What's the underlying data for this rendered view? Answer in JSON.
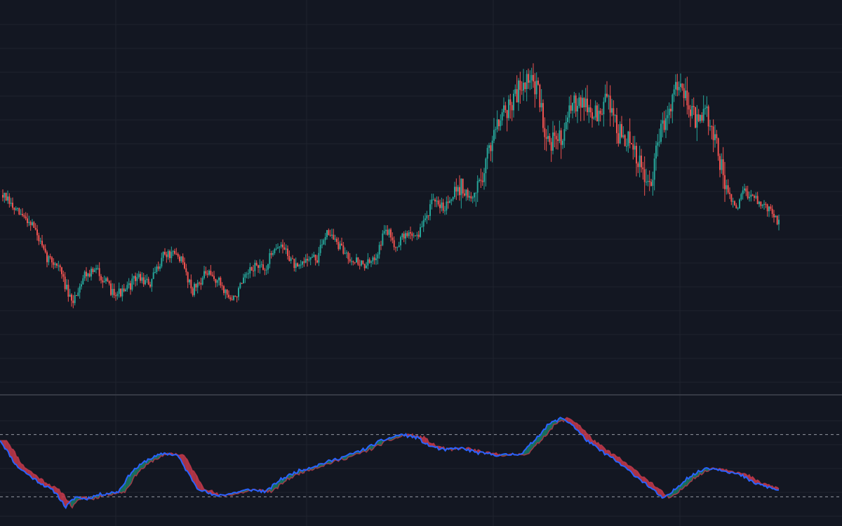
{
  "colors": {
    "background": "#131722",
    "grid": "#1f232e",
    "pane_divider": "#363a45",
    "up": "#26a69a",
    "down": "#ef5350",
    "osc_blue": "#2962ff",
    "osc_fill_up": "#1b7a64",
    "osc_fill_down": "#c2384a",
    "level_line": "#9598a1"
  },
  "chart_data": [
    {
      "type": "candlestick",
      "title": "",
      "price_range": [
        0,
        100
      ],
      "grid": true,
      "price_axis_labels": "none",
      "time_axis_labels": "none",
      "keypoints": [
        [
          0,
          58
        ],
        [
          8,
          52
        ],
        [
          18,
          48
        ],
        [
          26,
          36
        ],
        [
          34,
          33
        ],
        [
          42,
          19
        ],
        [
          50,
          30
        ],
        [
          58,
          31
        ],
        [
          66,
          24
        ],
        [
          74,
          23
        ],
        [
          82,
          29
        ],
        [
          90,
          26
        ],
        [
          98,
          37
        ],
        [
          108,
          36
        ],
        [
          116,
          24
        ],
        [
          124,
          30
        ],
        [
          132,
          27
        ],
        [
          140,
          20
        ],
        [
          148,
          28
        ],
        [
          154,
          33
        ],
        [
          160,
          31
        ],
        [
          166,
          40
        ],
        [
          172,
          39
        ],
        [
          180,
          31
        ],
        [
          186,
          36
        ],
        [
          192,
          35
        ],
        [
          198,
          46
        ],
        [
          206,
          39
        ],
        [
          212,
          36
        ],
        [
          220,
          33
        ],
        [
          226,
          34
        ],
        [
          234,
          46
        ],
        [
          240,
          40
        ],
        [
          246,
          44
        ],
        [
          254,
          44
        ],
        [
          262,
          55
        ],
        [
          270,
          54
        ],
        [
          278,
          62
        ],
        [
          286,
          56
        ],
        [
          294,
          67
        ],
        [
          302,
          86
        ],
        [
          310,
          90
        ],
        [
          318,
          99
        ],
        [
          326,
          97
        ],
        [
          332,
          79
        ],
        [
          338,
          76
        ],
        [
          346,
          86
        ],
        [
          352,
          94
        ],
        [
          358,
          88
        ],
        [
          364,
          86
        ],
        [
          370,
          93
        ],
        [
          376,
          80
        ],
        [
          382,
          77
        ],
        [
          390,
          67
        ],
        [
          396,
          60
        ],
        [
          400,
          77
        ],
        [
          406,
          88
        ],
        [
          412,
          99
        ],
        [
          418,
          93
        ],
        [
          424,
          83
        ],
        [
          430,
          87
        ],
        [
          436,
          75
        ],
        [
          442,
          60
        ],
        [
          448,
          52
        ],
        [
          452,
          60
        ],
        [
          460,
          56
        ],
        [
          468,
          53
        ],
        [
          474,
          48
        ]
      ],
      "n_candles": 475,
      "seed": 7
    },
    {
      "type": "area",
      "title": "",
      "ylim": [
        0,
        100
      ],
      "levels": [
        80,
        20
      ],
      "keypoints": [
        [
          0,
          75
        ],
        [
          10,
          50
        ],
        [
          20,
          38
        ],
        [
          34,
          24
        ],
        [
          40,
          10
        ],
        [
          46,
          20
        ],
        [
          52,
          18
        ],
        [
          60,
          22
        ],
        [
          72,
          25
        ],
        [
          80,
          44
        ],
        [
          90,
          56
        ],
        [
          100,
          62
        ],
        [
          108,
          60
        ],
        [
          114,
          44
        ],
        [
          120,
          29
        ],
        [
          130,
          21
        ],
        [
          140,
          23
        ],
        [
          152,
          27
        ],
        [
          162,
          25
        ],
        [
          170,
          36
        ],
        [
          180,
          44
        ],
        [
          196,
          52
        ],
        [
          212,
          60
        ],
        [
          222,
          66
        ],
        [
          232,
          74
        ],
        [
          244,
          80
        ],
        [
          254,
          77
        ],
        [
          260,
          70
        ],
        [
          270,
          65
        ],
        [
          280,
          67
        ],
        [
          292,
          62
        ],
        [
          306,
          60
        ],
        [
          318,
          62
        ],
        [
          326,
          76
        ],
        [
          334,
          90
        ],
        [
          342,
          96
        ],
        [
          348,
          90
        ],
        [
          356,
          76
        ],
        [
          364,
          66
        ],
        [
          372,
          58
        ],
        [
          382,
          46
        ],
        [
          392,
          34
        ],
        [
          400,
          23
        ],
        [
          404,
          18
        ],
        [
          410,
          26
        ],
        [
          418,
          38
        ],
        [
          430,
          48
        ],
        [
          440,
          46
        ],
        [
          452,
          40
        ],
        [
          458,
          34
        ],
        [
          466,
          30
        ],
        [
          474,
          26
        ]
      ],
      "n_points": 475,
      "seed": 11
    }
  ]
}
